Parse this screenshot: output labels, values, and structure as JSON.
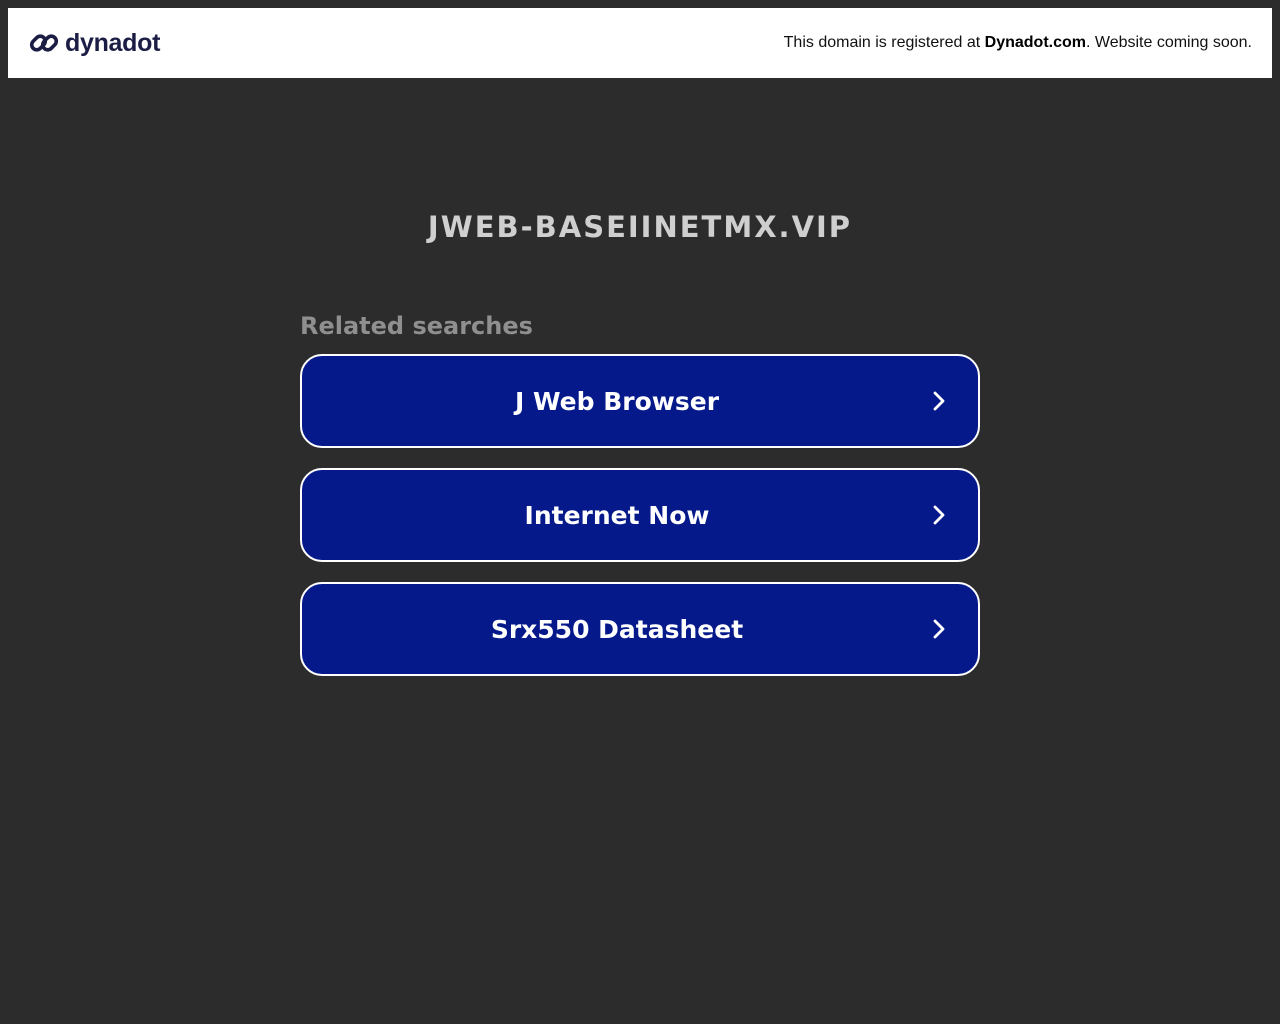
{
  "header": {
    "brand_name": "dynadot",
    "brand_icon": "dynadot-logo-icon",
    "notice_prefix": "This domain is registered at ",
    "notice_link": "Dynadot.com",
    "notice_suffix": ". Website coming soon."
  },
  "main": {
    "domain": "JWEB-BASEIINETMX.VIP",
    "related_heading": "Related searches",
    "searches": [
      {
        "label": "J Web Browser",
        "icon": "chevron-right-icon"
      },
      {
        "label": "Internet Now",
        "icon": "chevron-right-icon"
      },
      {
        "label": "Srx550 Datasheet",
        "icon": "chevron-right-icon"
      }
    ]
  },
  "colors": {
    "page_background": "#2c2c2c",
    "header_background": "#ffffff",
    "brand_color": "#1b1d45",
    "button_background": "#05198a",
    "button_border": "#ffffff",
    "domain_text": "#cfcfcf",
    "heading_text": "#8f8f8f"
  }
}
